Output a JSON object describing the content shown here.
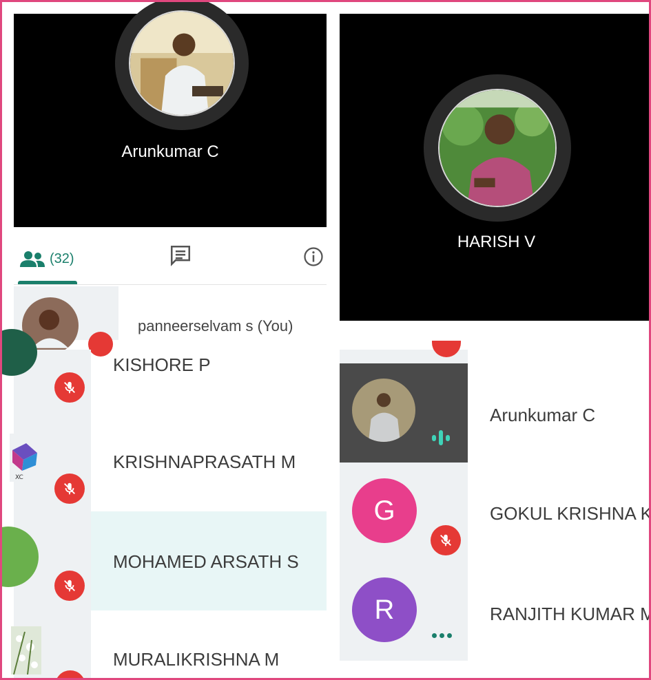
{
  "tiles": {
    "top_left_name": "Arunkumar C",
    "top_right_name": "HARISH V"
  },
  "tabs": {
    "people_count": "(32)"
  },
  "colors": {
    "accent": "#1a7f6b",
    "mute_red": "#e53935",
    "frame_pink": "#e0477e",
    "highlight_row": "#e8f6f6",
    "avatar_g": "#e83e8c",
    "avatar_r": "#8e4fc7"
  },
  "left_list": {
    "you": "panneerselvam s (You)",
    "items": [
      {
        "name": "KISHORE P"
      },
      {
        "name": "KRISHNAPRASATH M"
      },
      {
        "name": "MOHAMED ARSATH S"
      },
      {
        "name": "MURALIKRISHNA M"
      }
    ]
  },
  "right_list": {
    "items": [
      {
        "name": "Arunkumar C"
      },
      {
        "name": "GOKUL KRISHNA K",
        "initial": "G"
      },
      {
        "name": "RANJITH KUMAR M",
        "initial": "R"
      }
    ]
  }
}
